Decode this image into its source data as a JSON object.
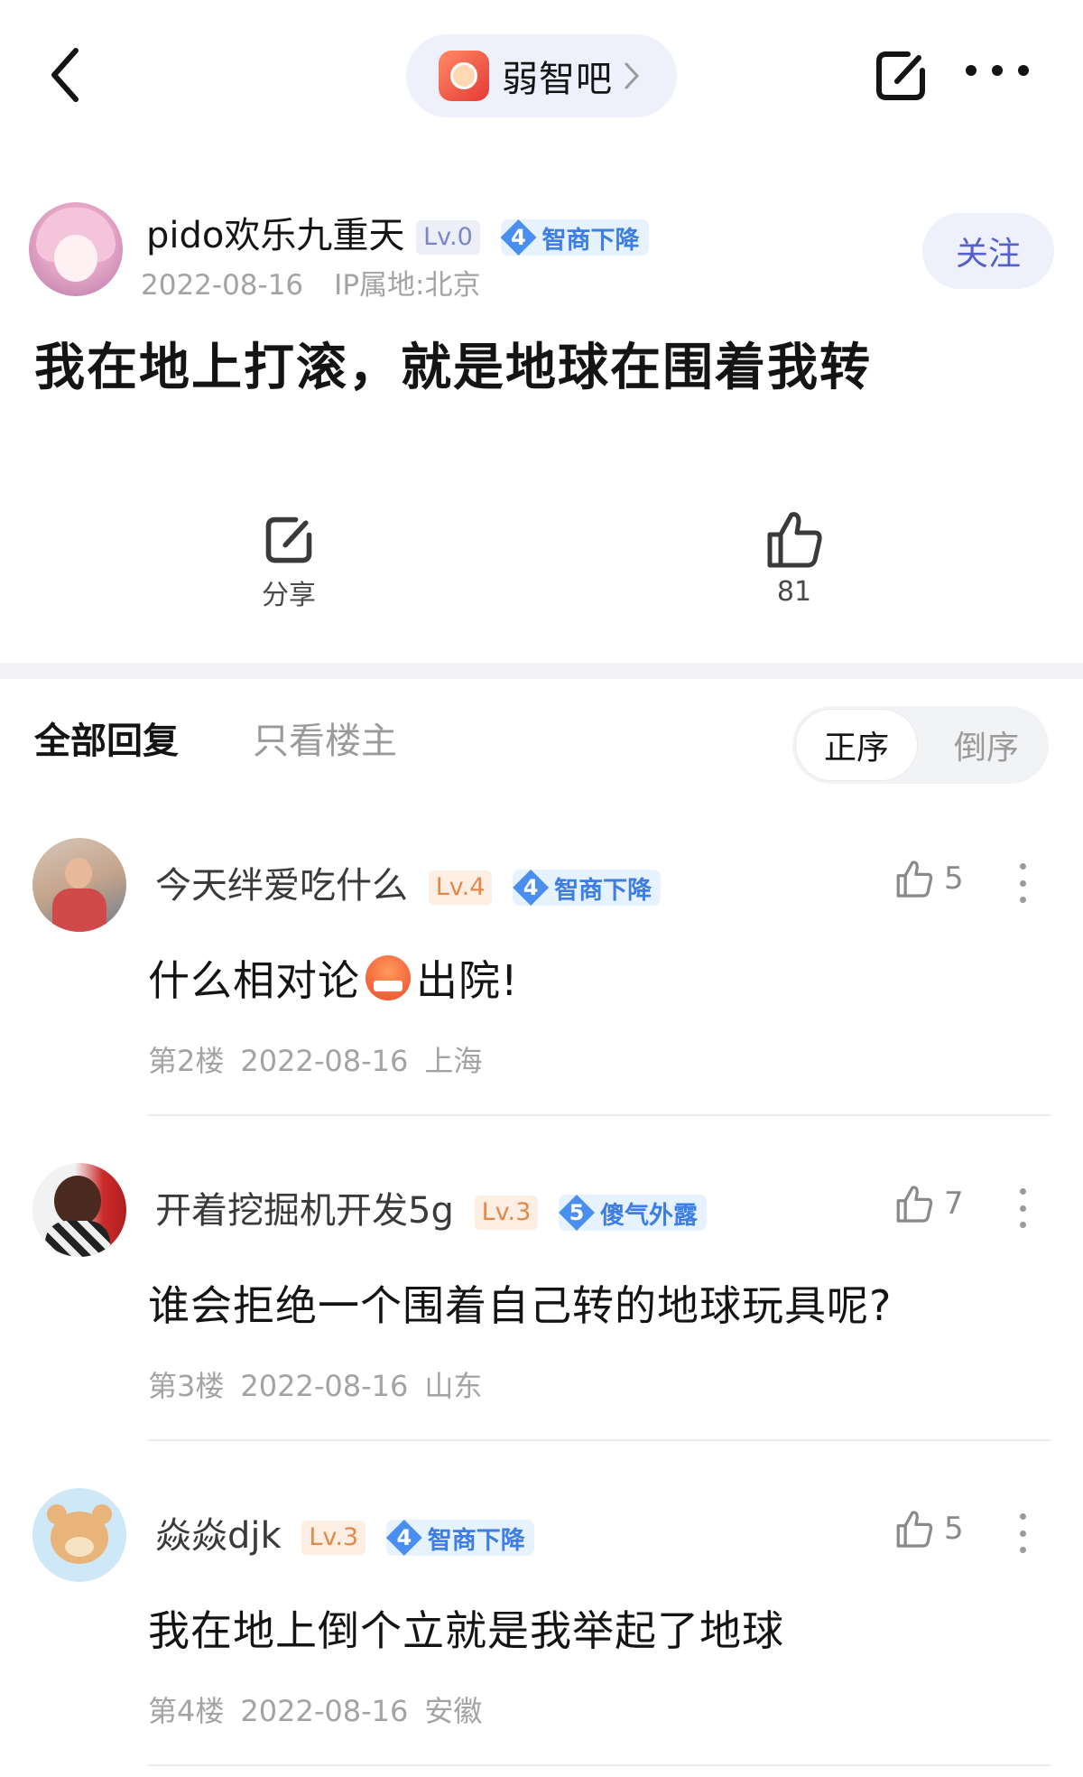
{
  "topbar": {
    "forum_name": "弱智吧"
  },
  "post": {
    "author": {
      "name": "pido欢乐九重天",
      "level": "Lv.0",
      "tag_num": "4",
      "tag_text": "智商下降",
      "date": "2022-08-16",
      "ip": "IP属地:北京"
    },
    "follow_label": "关注",
    "title": "我在地上打滚，就是地球在围着我转",
    "share_label": "分享",
    "like_count": "81"
  },
  "tabs": {
    "all": "全部回复",
    "op_only": "只看楼主",
    "sort_asc": "正序",
    "sort_desc": "倒序"
  },
  "comments": [
    {
      "name": "今天绊爱吃什么",
      "level": "Lv.4",
      "tag_num": "4",
      "tag_text": "智商下降",
      "likes": "5",
      "text_a": "什么相对论",
      "emoji": "angry-face",
      "text_b": "出院!",
      "floor": "第2楼",
      "date": "2022-08-16",
      "location": "上海"
    },
    {
      "name": "开着挖掘机开发5g",
      "level": "Lv.3",
      "tag_num": "5",
      "tag_text": "傻气外露",
      "likes": "7",
      "text": "谁会拒绝一个围着自己转的地球玩具呢?",
      "floor": "第3楼",
      "date": "2022-08-16",
      "location": "山东"
    },
    {
      "name": "焱焱djk",
      "level": "Lv.3",
      "tag_num": "4",
      "tag_text": "智商下降",
      "likes": "5",
      "text": "我在地上倒个立就是我举起了地球",
      "floor": "第4楼",
      "date": "2022-08-16",
      "location": "安徽"
    }
  ],
  "colors": {
    "accent": "#5660c8",
    "tag_blue": "#4a8ff0",
    "pill_bg": "#eef0fb"
  }
}
